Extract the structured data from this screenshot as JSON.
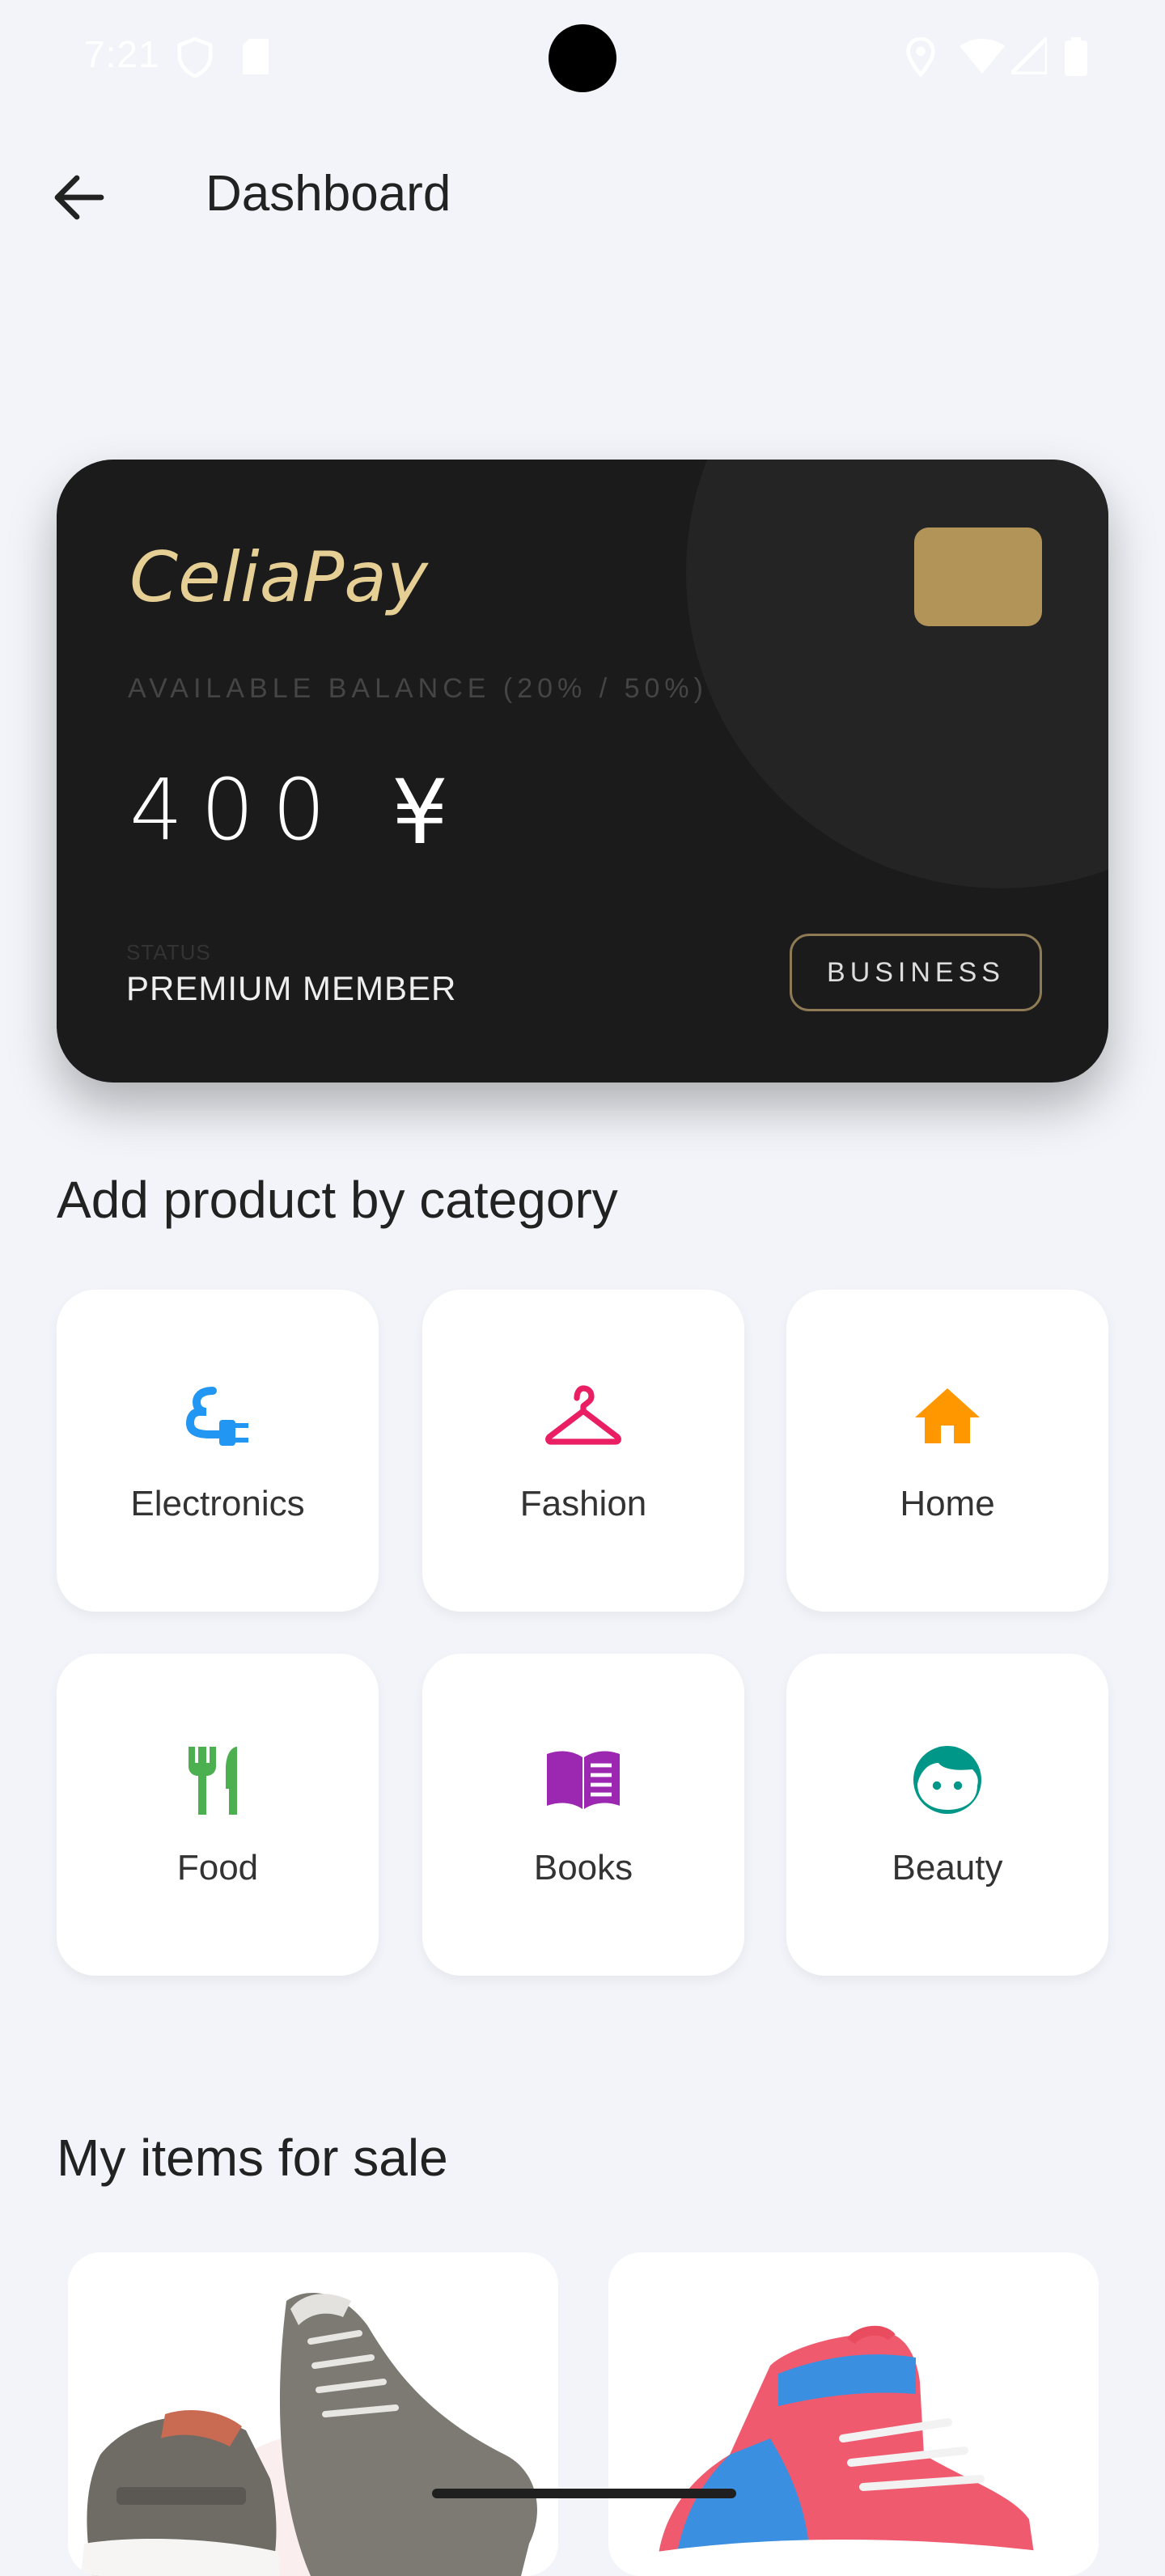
{
  "status_bar": {
    "time": "7:21",
    "icons": [
      "shield-icon",
      "sd-card-icon",
      "location-icon",
      "wifi-icon",
      "signal-icon",
      "battery-icon"
    ]
  },
  "app_bar": {
    "title": "Dashboard",
    "back_icon": "arrow-back-icon"
  },
  "card": {
    "brand": "CeliaPay",
    "balance_label": "AVAILABLE BALANCE (20% / 50%)",
    "amount": "400",
    "currency": "¥",
    "status_label": "STATUS",
    "status_value": "PREMIUM MEMBER",
    "badge": "BUSINESS",
    "colors": {
      "background": "#1b1b1b",
      "brand": "#e6cf94",
      "chip": "#b29358"
    }
  },
  "categories_section": {
    "title": "Add product by category",
    "items": [
      {
        "label": "Electronics",
        "icon": "power-plug-icon",
        "color": "#2196f3"
      },
      {
        "label": "Fashion",
        "icon": "hanger-icon",
        "color": "#e91e63"
      },
      {
        "label": "Home",
        "icon": "home-icon",
        "color": "#ff9800"
      },
      {
        "label": "Food",
        "icon": "restaurant-icon",
        "color": "#4caf50"
      },
      {
        "label": "Books",
        "icon": "book-icon",
        "color": "#9c27b0"
      },
      {
        "label": "Beauty",
        "icon": "face-icon",
        "color": "#009688"
      }
    ]
  },
  "items_section": {
    "title": "My items for sale",
    "items": [
      {
        "image": "grey-sneakers-image"
      },
      {
        "image": "blue-red-high-top-sneaker-image"
      }
    ]
  }
}
